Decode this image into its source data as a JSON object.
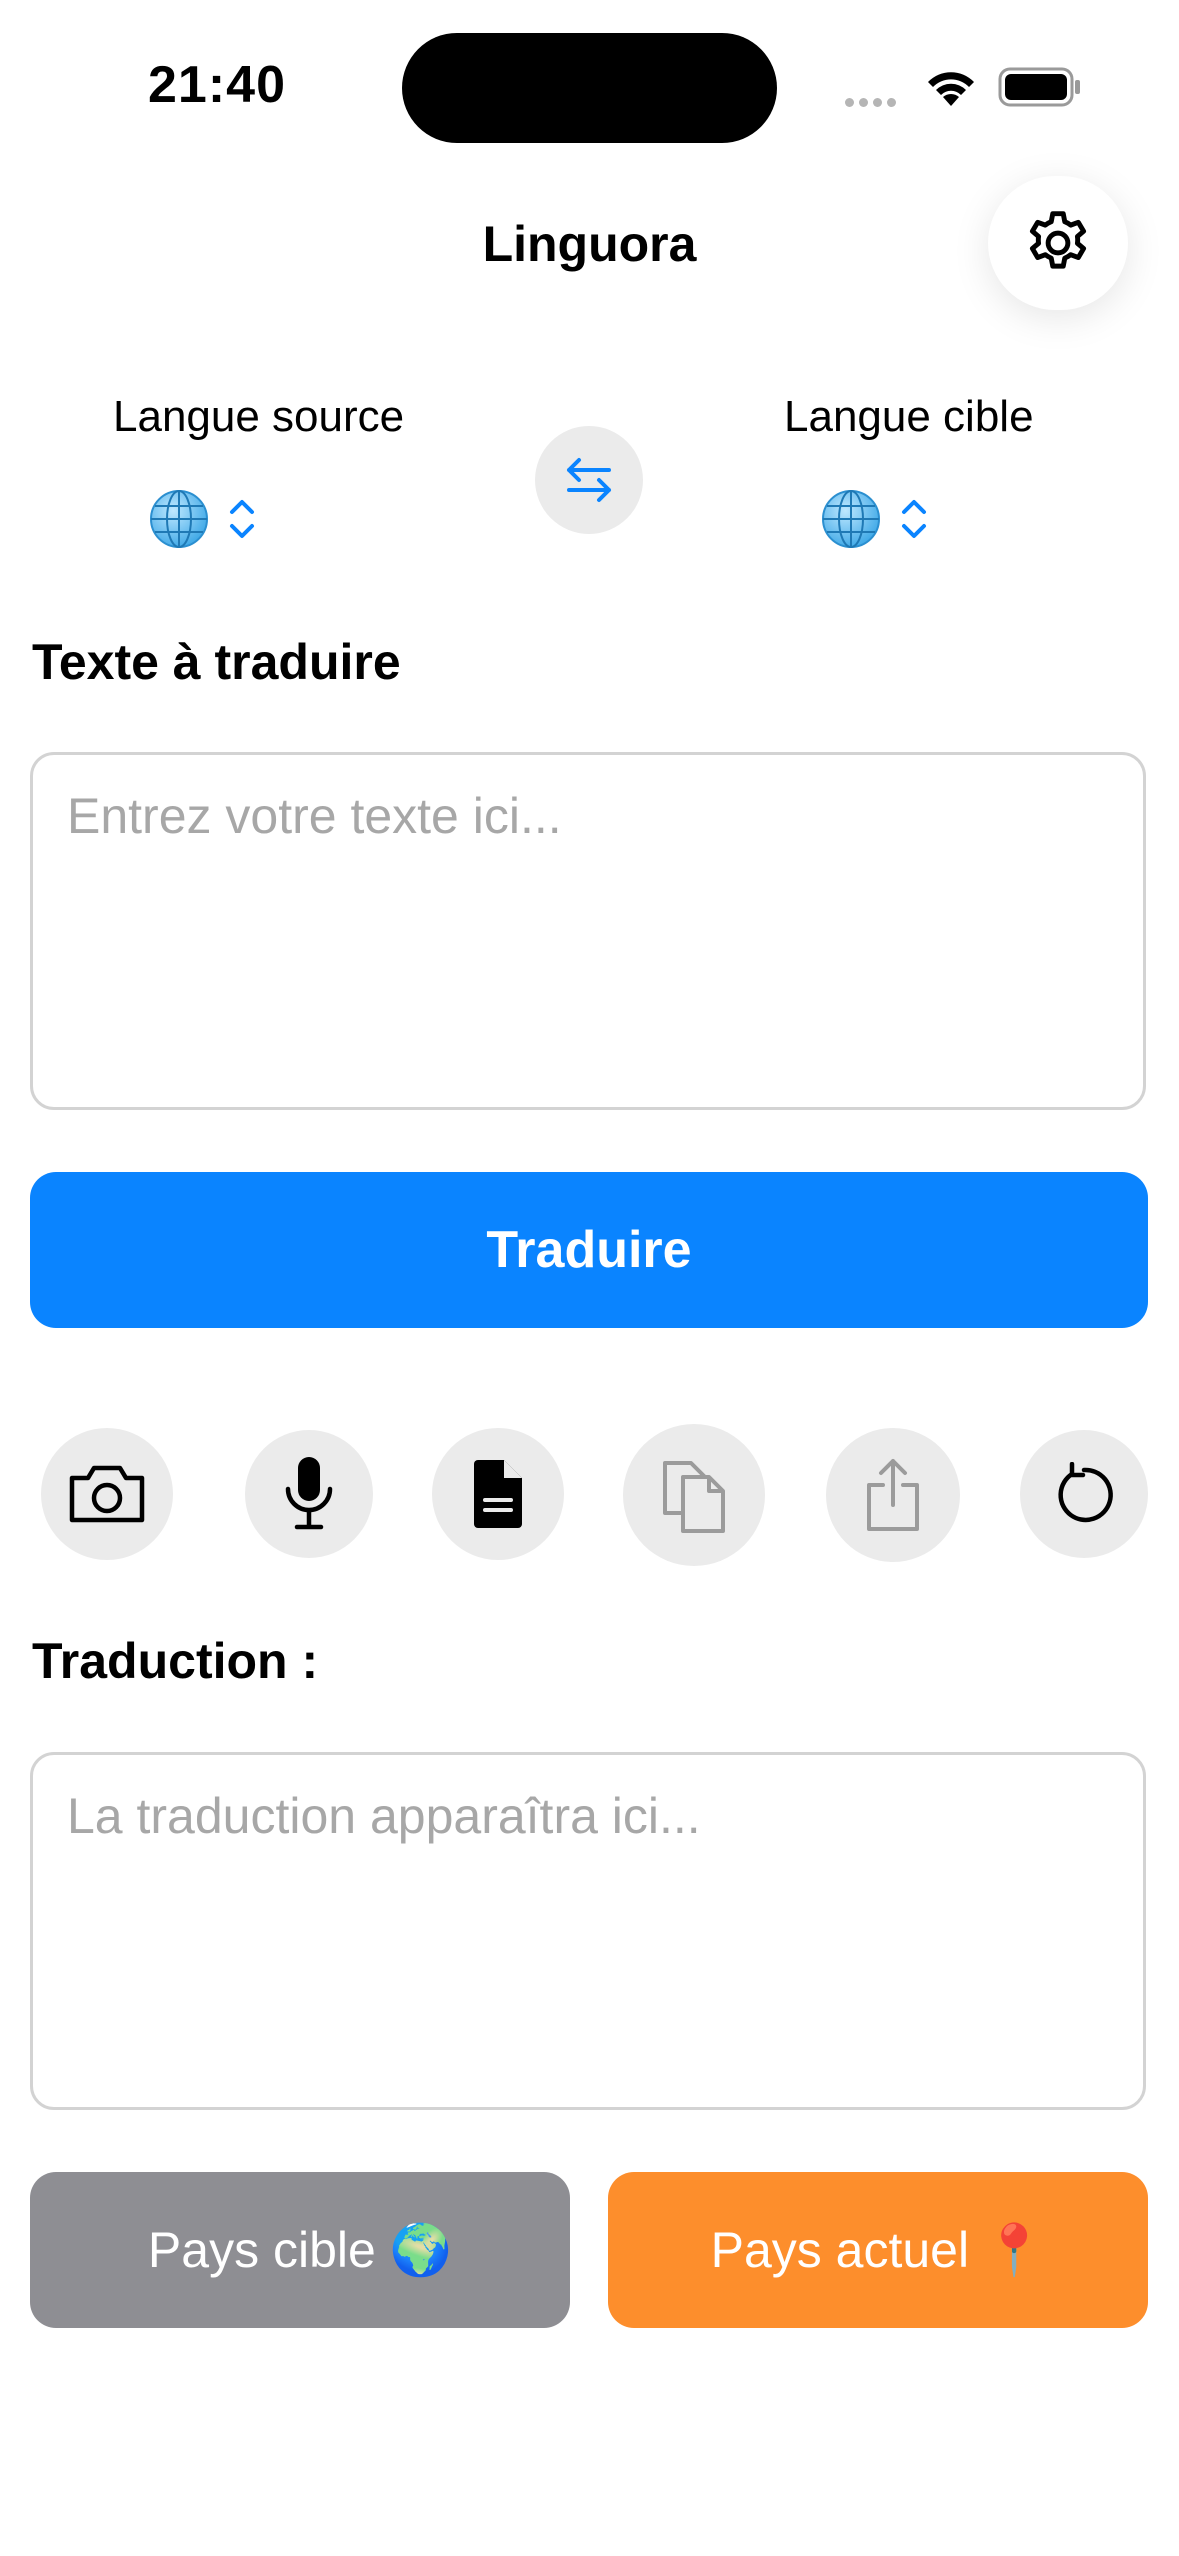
{
  "status_bar": {
    "time": "21:40"
  },
  "header": {
    "title": "Linguora",
    "settings_icon": "gear-icon"
  },
  "languages": {
    "source_label": "Langue source",
    "target_label": "Langue cible",
    "globe_color": "#0a84ff",
    "swap_icon": "arrows-swap-icon"
  },
  "input": {
    "section_title": "Texte à traduire",
    "placeholder": "Entrez votre texte ici..."
  },
  "translate_button": {
    "label": "Traduire",
    "color": "#0a84ff"
  },
  "tools": [
    "camera-icon",
    "microphone-icon",
    "document-icon",
    "copy-icon",
    "share-icon",
    "reset-icon"
  ],
  "output": {
    "section_title": "Traduction :",
    "placeholder": "La traduction apparaîtra ici..."
  },
  "bottom_buttons": {
    "target_country_label": "Pays cible",
    "target_country_emoji": "🌍",
    "current_country_label": "Pays actuel",
    "current_country_emoji": "📍",
    "target_color": "#8e8e93",
    "current_color": "#fd8e2c"
  }
}
